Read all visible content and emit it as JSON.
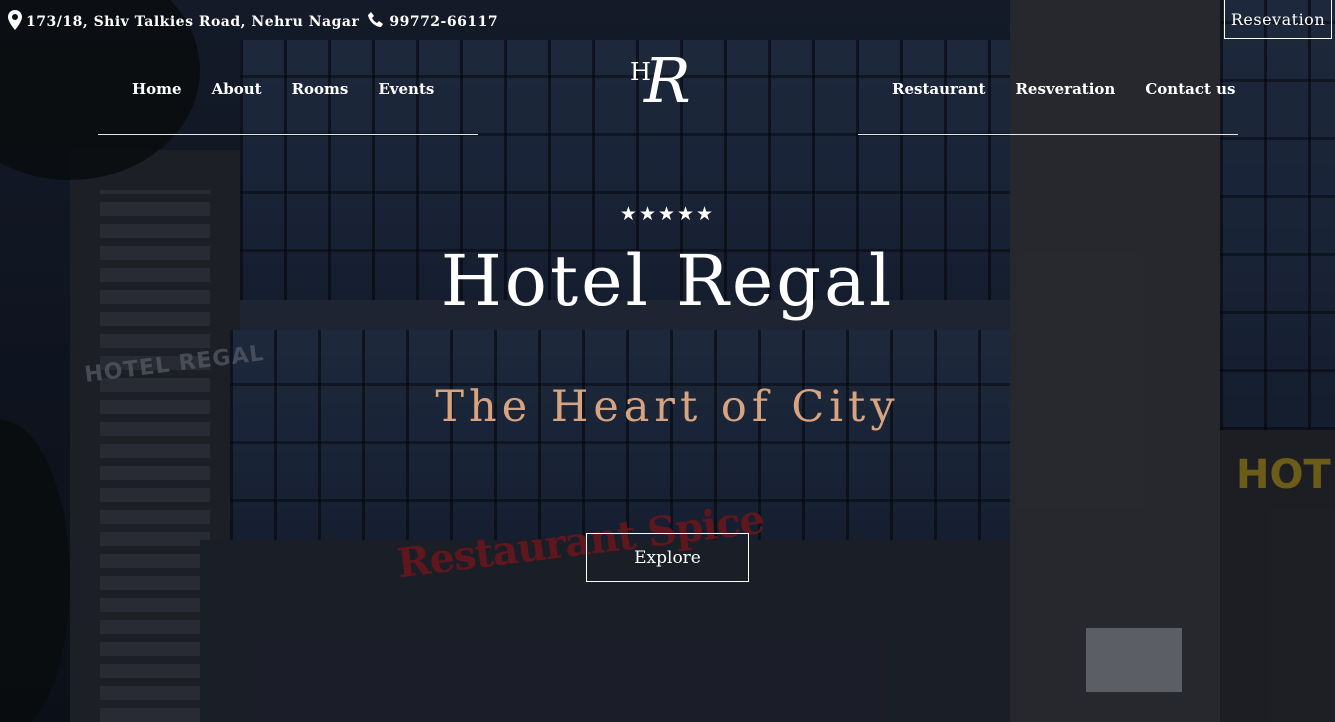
{
  "topbar": {
    "address_icon": "map-marker-icon",
    "address": "173/18, Shiv Talkies Road, Nehru Nagar",
    "phone_icon": "phone-icon",
    "phone": "99772-66117",
    "reservation_button": "Resevation"
  },
  "nav": {
    "left": [
      "Home",
      "About",
      "Rooms",
      "Events"
    ],
    "right": [
      "Restaurant",
      "Resveration",
      "Contact us"
    ]
  },
  "logo": {
    "small": "H",
    "large": "R"
  },
  "hero": {
    "stars": "★★★★★",
    "title": "Hotel Regal",
    "subtitle": "The Heart of City",
    "cta": "Explore"
  },
  "colors": {
    "accent": "#d8a37f",
    "text": "#ffffff"
  }
}
